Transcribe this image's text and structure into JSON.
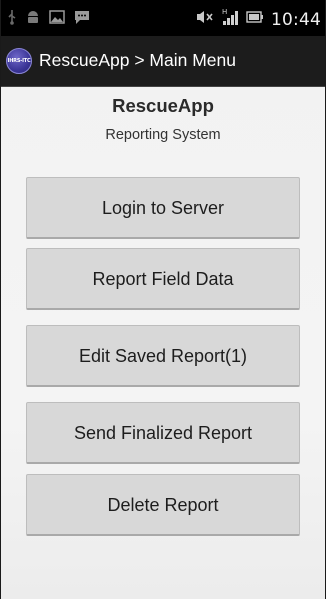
{
  "status_bar": {
    "time": "10:44",
    "network_label": "H",
    "icons": [
      "usb-debug-icon",
      "android-icon",
      "image-icon",
      "chat-icon",
      "mute-icon",
      "signal-icon",
      "battery-icon"
    ]
  },
  "action_bar": {
    "logo_text": "IHRS-ITC",
    "title": "RescueApp > Main Menu"
  },
  "header": {
    "app_name": "RescueApp",
    "subtitle": "Reporting System"
  },
  "menu": {
    "items": [
      {
        "label": "Login to Server"
      },
      {
        "label": "Report Field Data"
      },
      {
        "label": "Edit Saved Report(1)"
      },
      {
        "label": "Send Finalized Report"
      },
      {
        "label": "Delete Report"
      }
    ]
  },
  "colors": {
    "status_bar": "#000000",
    "action_bar": "#1c1c1c",
    "button_bg": "#d8d8d8",
    "screen_bg": "#f2f2f2"
  }
}
